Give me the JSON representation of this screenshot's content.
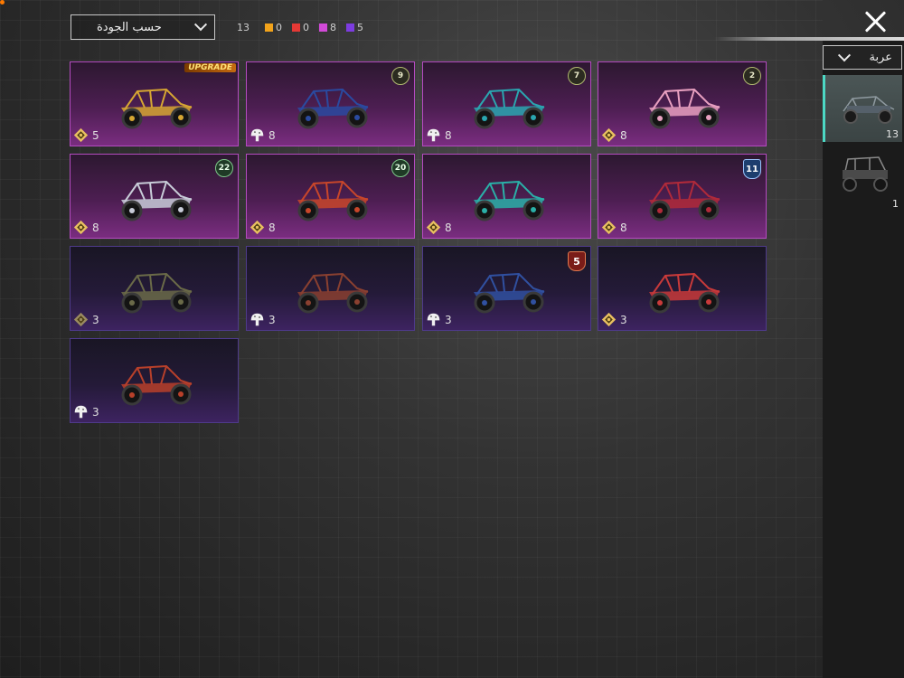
{
  "header": {
    "sort_label": "حسب الجودة",
    "total_count": "13",
    "quality_counts": [
      {
        "color": "#f2a31b",
        "count": "0"
      },
      {
        "color": "#e53935",
        "count": "0"
      },
      {
        "color": "#d24ad8",
        "count": "8"
      },
      {
        "color": "#7d3ce0",
        "count": "5"
      }
    ]
  },
  "sidebar": {
    "category_label": "عربة",
    "items": [
      {
        "name": "buggy",
        "count": "13",
        "active": true
      },
      {
        "name": "utv",
        "count": "1",
        "active": false
      }
    ]
  },
  "cards": [
    {
      "rarity": "epic",
      "tier": "crest",
      "level": "5",
      "badge": "UPGRADE",
      "badge_style": "upgrade",
      "color": "#d6a632"
    },
    {
      "rarity": "epic",
      "tier": "mushroom",
      "level": "8",
      "badge": "9",
      "badge_style": "ring",
      "color": "#2a4aa0"
    },
    {
      "rarity": "epic",
      "tier": "mushroom",
      "level": "8",
      "badge": "7",
      "badge_style": "ring",
      "color": "#2aa6b0"
    },
    {
      "rarity": "epic",
      "tier": "crest",
      "level": "8",
      "badge": "2",
      "badge_style": "ring",
      "color": "#e8a0c0"
    },
    {
      "rarity": "epic",
      "tier": "crest",
      "level": "8",
      "badge": "22",
      "badge_style": "green",
      "color": "#c8ccd8"
    },
    {
      "rarity": "epic",
      "tier": "crest",
      "level": "8",
      "badge": "20",
      "badge_style": "green",
      "color": "#c8462a"
    },
    {
      "rarity": "epic",
      "tier": "crest",
      "level": "8",
      "badge": "",
      "badge_style": "",
      "color": "#2ab0a8"
    },
    {
      "rarity": "epic",
      "tier": "crest",
      "level": "8",
      "badge": "11",
      "badge_style": "shield-blue",
      "color": "#b02a3a"
    },
    {
      "rarity": "rare",
      "tier": "crest-dark",
      "level": "3",
      "badge": "",
      "badge_style": "",
      "color": "#6a6a48"
    },
    {
      "rarity": "rare",
      "tier": "mushroom",
      "level": "3",
      "badge": "",
      "badge_style": "",
      "color": "#8a4030"
    },
    {
      "rarity": "rare",
      "tier": "mushroom",
      "level": "3",
      "badge": "5",
      "badge_style": "shield-red",
      "color": "#3050a0"
    },
    {
      "rarity": "rare",
      "tier": "crest",
      "level": "3",
      "badge": "",
      "badge_style": "",
      "color": "#c83a3a"
    },
    {
      "rarity": "rare",
      "tier": "mushroom",
      "level": "3",
      "badge": "",
      "badge_style": "",
      "color": "#b8402a"
    }
  ]
}
